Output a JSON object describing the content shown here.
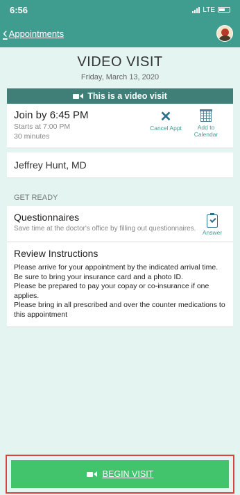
{
  "status_bar": {
    "time": "6:56",
    "network": "LTE"
  },
  "nav": {
    "back_label": "Appointments"
  },
  "header": {
    "title": "VIDEO VISIT",
    "date": "Friday, March 13, 2020"
  },
  "banner": {
    "text": "This is a video visit"
  },
  "appointment": {
    "join_by": "Join by 6:45 PM",
    "starts_at": "Starts at 7:00 PM",
    "duration": "30 minutes",
    "cancel_label": "Cancel Appt",
    "calendar_label_1": "Add to",
    "calendar_label_2": "Calendar"
  },
  "provider": {
    "name": "Jeffrey Hunt, MD"
  },
  "get_ready": {
    "label": "GET READY"
  },
  "questionnaires": {
    "title": "Questionnaires",
    "subtitle": "Save time at the doctor's office by filling out questionnaires.",
    "answer_label": "Answer"
  },
  "instructions": {
    "title": "Review Instructions",
    "lines": [
      "Please arrive for your appointment by the indicated arrival time. Be sure to bring your insurance card and a photo ID.",
      "Please be prepared to pay your copay or co-insurance if one applies.",
      "Please bring in all prescribed and over the counter medications to this appointment"
    ]
  },
  "begin": {
    "label": "BEGIN VISIT"
  },
  "colors": {
    "teal": "#3f9d90",
    "banner": "#3f7f78",
    "background": "#e3f4f1",
    "button_green": "#41c46b",
    "highlight_red": "#d8423f"
  }
}
